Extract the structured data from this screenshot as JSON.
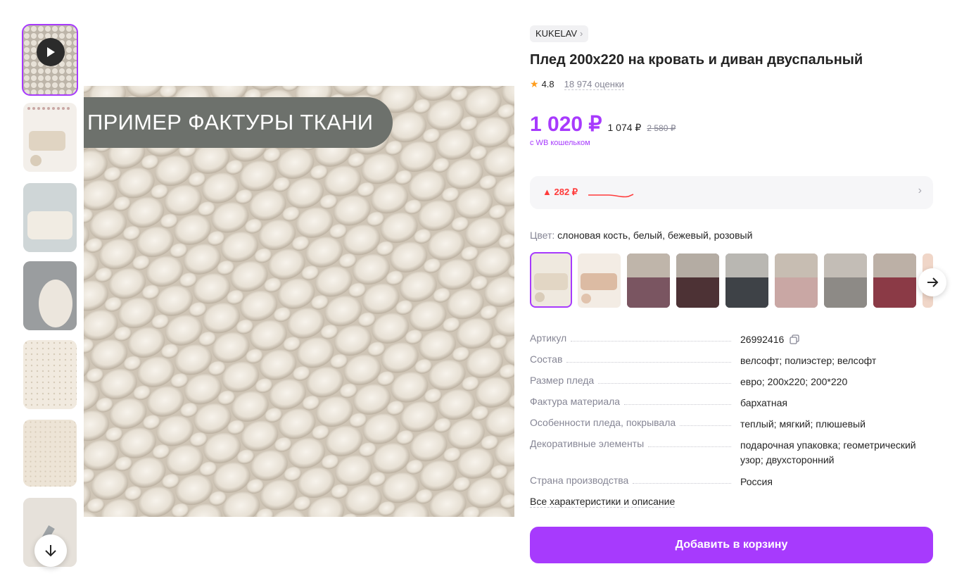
{
  "gallery": {
    "main_overlay_text": "ПРИМЕР ФАКТУРЫ ТКАНИ",
    "thumbnails": [
      {
        "kind": "video"
      },
      {
        "kind": "image"
      },
      {
        "kind": "image"
      },
      {
        "kind": "image"
      },
      {
        "kind": "image"
      },
      {
        "kind": "image"
      },
      {
        "kind": "image"
      }
    ]
  },
  "product": {
    "brand": "KUKELAV",
    "title": "Плед 200х220 на кровать и диван двуспальный",
    "rating": "4.8",
    "reviews": "18 974 оценки",
    "price": "1 020 ₽",
    "price_no_wallet": "1 074 ₽",
    "price_old": "2 580 ₽",
    "wallet_note": "с WB кошельком",
    "price_change": "▲ 282 ₽",
    "color_label": "Цвет:",
    "color_value": "слоновая кость, белый, бежевый, розовый",
    "specs": [
      {
        "name": "Артикул",
        "value": "26992416"
      },
      {
        "name": "Состав",
        "value": "велсофт; полиэстер; велсофт"
      },
      {
        "name": "Размер пледа",
        "value": "евро; 200х220; 200*220"
      },
      {
        "name": "Фактура материала",
        "value": "бархатная"
      },
      {
        "name": "Особенности пледа, покрывала",
        "value": "теплый; мягкий; плюшевый"
      },
      {
        "name": "Декоративные элементы",
        "value": "подарочная упаковка; геометрический узор; двухсторонний"
      },
      {
        "name": "Страна производства",
        "value": "Россия"
      }
    ],
    "all_characteristics": "Все характеристики и описание",
    "add_to_cart": "Добавить в корзину"
  },
  "colors": {
    "accent": "#a73afd",
    "price_increase": "#ff3b3b",
    "rating_star": "#ff9d1c",
    "swatches": [
      "#e9e1d4",
      "#e4c9b2",
      "#7a5561",
      "#4d3235",
      "#3e4247",
      "#c9a7a4",
      "#8d8a86",
      "#8b3a46"
    ]
  }
}
